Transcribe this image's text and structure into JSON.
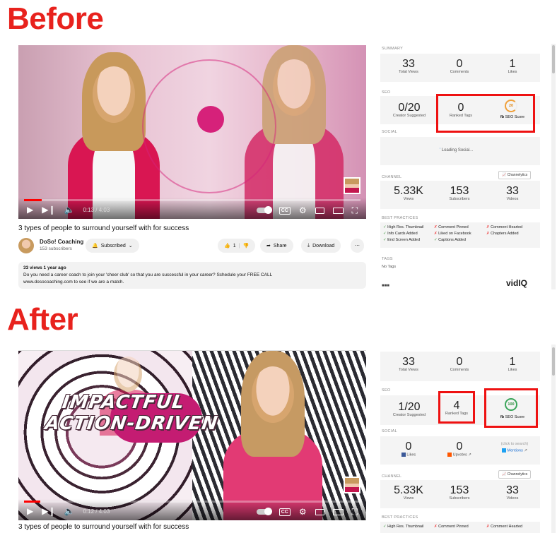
{
  "headings": {
    "before": "Before",
    "after": "After"
  },
  "video_before": {
    "time": "0:13 / 4:03",
    "progress": 0.053,
    "title": "3 types of people to surround yourself with for success",
    "channel_name": "DoSo! Coaching",
    "subscribers": "153 subscribers",
    "subscribed_label": "Subscribed",
    "likes": "1",
    "share_label": "Share",
    "download_label": "Download",
    "desc_meta": "33 views  1 year ago",
    "desc_line1": "Do you need a career coach to join your 'cheer club' so that you are successful in your career? Schedule your FREE CALL",
    "desc_line2": "www.dosocoaching.com to see if we are a match."
  },
  "video_after": {
    "time": "0:12 / 4:03",
    "progress": 0.049,
    "overlay_line1": "IMPACTFUL",
    "overlay_line2": "ACTION-DRIVEN",
    "title": "3 types of people to surround yourself with for success"
  },
  "panel_before": {
    "summary_label": "SUMMARY",
    "total_views": "33",
    "total_views_label": "Total Views",
    "comments": "0",
    "comments_label": "Comments",
    "likes": "1",
    "likes_label": "Likes",
    "seo_label": "SEO",
    "creator_suggested": "0/20",
    "creator_suggested_label": "Creator Suggested",
    "ranked_tags": "0",
    "ranked_tags_label": "Ranked Tags",
    "seo_score": "20",
    "seo_score_label": "SEO Score",
    "social_label": "SOCIAL",
    "loading_social": "Loading Social...",
    "channel_label": "CHANNEL",
    "channelytics_label": "Channelytics",
    "ch_views": "5.33K",
    "ch_views_label": "Views",
    "ch_subs": "153",
    "ch_subs_label": "Subscribers",
    "ch_videos": "33",
    "ch_videos_label": "Videos",
    "bp_label": "BEST PRACTICES",
    "bp": [
      {
        "text": "High Res. Thumbnail",
        "ok": true
      },
      {
        "text": "Comment Pinned",
        "ok": false
      },
      {
        "text": "Comment Hearted",
        "ok": false
      },
      {
        "text": "Info Cards Added",
        "ok": true
      },
      {
        "text": "Liked on Facebook",
        "ok": false
      },
      {
        "text": "Chapters Added",
        "ok": false
      },
      {
        "text": "End Screen Added",
        "ok": true
      },
      {
        "text": "Captions Added",
        "ok": true
      }
    ],
    "tags_label": "TAGS",
    "no_tags": "No Tags",
    "vidiq": "vidIQ"
  },
  "panel_after": {
    "total_views": "33",
    "total_views_label": "Total Views",
    "comments": "0",
    "comments_label": "Comments",
    "likes": "1",
    "likes_label": "Likes",
    "seo_label": "SEO",
    "creator_suggested": "1/20",
    "creator_suggested_label": "Creator Suggested",
    "ranked_tags": "4",
    "ranked_tags_label": "Ranked Tags",
    "seo_score": "100",
    "seo_score_label": "SEO Score",
    "social_label": "SOCIAL",
    "social_likes": "0",
    "social_likes_label": "Likes",
    "social_upvotes": "0",
    "social_upvotes_label": "Upvotes",
    "click_to_search": "(click to search)",
    "mentions_label": "Mentions",
    "channel_label": "CHANNEL",
    "channelytics_label": "Channelytics",
    "ch_views": "5.33K",
    "ch_views_label": "Views",
    "ch_subs": "153",
    "ch_subs_label": "Subscribers",
    "ch_videos": "33",
    "ch_videos_label": "Videos",
    "bp_label": "BEST PRACTICES",
    "bp": [
      {
        "text": "High Res. Thumbnail",
        "ok": true
      },
      {
        "text": "Comment Pinned",
        "ok": false
      },
      {
        "text": "Comment Hearted",
        "ok": false
      }
    ]
  },
  "colors": {
    "accent_red": "#e8221d",
    "youtube_red": "#ff0000",
    "ok_green": "#3a9a3a",
    "fail_red": "#e33"
  }
}
